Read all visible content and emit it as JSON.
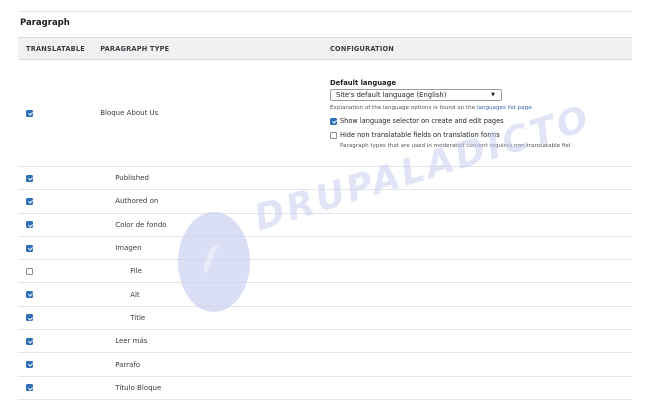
{
  "section": {
    "title": "Paragraph"
  },
  "columns": {
    "translatable": "TRANSLATABLE",
    "type": "PARAGRAPH TYPE",
    "configuration": "CONFIGURATION"
  },
  "main_row": {
    "label": "Bloque About Us",
    "checked": true,
    "config": {
      "default_language_label": "Default language",
      "default_language_value": "Site's default language (English)",
      "explanation_text": "Explanation of the language options is found on the ",
      "explanation_link": "languages list page",
      "explanation_end": ".",
      "show_selector_label": "Show language selector on create and edit pages",
      "show_selector_checked": true,
      "hide_nontranslatable_label": "Hide non translatable fields on translation forms",
      "hide_nontranslatable_checked": false,
      "hide_desc": "Paragraph types that are used in moderated content requires non-translatable fiel"
    }
  },
  "rows": [
    {
      "label": "Published",
      "checked": true,
      "level": 1
    },
    {
      "label": "Authored on",
      "checked": true,
      "level": 1
    },
    {
      "label": "Color de fondo",
      "checked": true,
      "level": 1
    },
    {
      "label": "Imagen",
      "checked": true,
      "level": 1
    },
    {
      "label": "File",
      "checked": false,
      "level": 2
    },
    {
      "label": "Alt",
      "checked": true,
      "level": 2
    },
    {
      "label": "Title",
      "checked": true,
      "level": 2
    },
    {
      "label": "Leer más",
      "checked": true,
      "level": 1
    },
    {
      "label": "Parrafo",
      "checked": true,
      "level": 1
    },
    {
      "label": "Título Bloque",
      "checked": true,
      "level": 1
    }
  ],
  "watermark": {
    "text": "DRUPALADICTO"
  }
}
